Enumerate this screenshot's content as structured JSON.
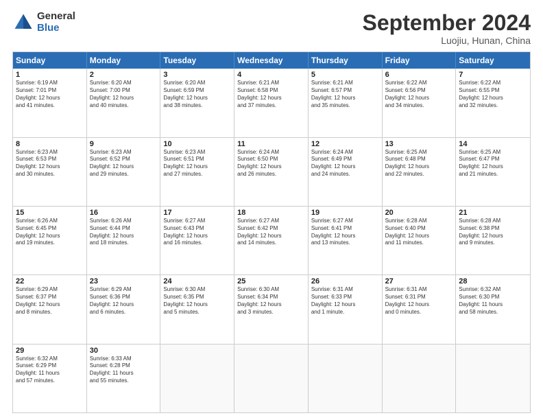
{
  "logo": {
    "general": "General",
    "blue": "Blue"
  },
  "title": "September 2024",
  "location": "Luojiu, Hunan, China",
  "days_header": [
    "Sunday",
    "Monday",
    "Tuesday",
    "Wednesday",
    "Thursday",
    "Friday",
    "Saturday"
  ],
  "weeks": [
    [
      {
        "day": "1",
        "lines": [
          "Sunrise: 6:19 AM",
          "Sunset: 7:01 PM",
          "Daylight: 12 hours",
          "and 41 minutes."
        ]
      },
      {
        "day": "2",
        "lines": [
          "Sunrise: 6:20 AM",
          "Sunset: 7:00 PM",
          "Daylight: 12 hours",
          "and 40 minutes."
        ]
      },
      {
        "day": "3",
        "lines": [
          "Sunrise: 6:20 AM",
          "Sunset: 6:59 PM",
          "Daylight: 12 hours",
          "and 38 minutes."
        ]
      },
      {
        "day": "4",
        "lines": [
          "Sunrise: 6:21 AM",
          "Sunset: 6:58 PM",
          "Daylight: 12 hours",
          "and 37 minutes."
        ]
      },
      {
        "day": "5",
        "lines": [
          "Sunrise: 6:21 AM",
          "Sunset: 6:57 PM",
          "Daylight: 12 hours",
          "and 35 minutes."
        ]
      },
      {
        "day": "6",
        "lines": [
          "Sunrise: 6:22 AM",
          "Sunset: 6:56 PM",
          "Daylight: 12 hours",
          "and 34 minutes."
        ]
      },
      {
        "day": "7",
        "lines": [
          "Sunrise: 6:22 AM",
          "Sunset: 6:55 PM",
          "Daylight: 12 hours",
          "and 32 minutes."
        ]
      }
    ],
    [
      {
        "day": "8",
        "lines": [
          "Sunrise: 6:23 AM",
          "Sunset: 6:53 PM",
          "Daylight: 12 hours",
          "and 30 minutes."
        ]
      },
      {
        "day": "9",
        "lines": [
          "Sunrise: 6:23 AM",
          "Sunset: 6:52 PM",
          "Daylight: 12 hours",
          "and 29 minutes."
        ]
      },
      {
        "day": "10",
        "lines": [
          "Sunrise: 6:23 AM",
          "Sunset: 6:51 PM",
          "Daylight: 12 hours",
          "and 27 minutes."
        ]
      },
      {
        "day": "11",
        "lines": [
          "Sunrise: 6:24 AM",
          "Sunset: 6:50 PM",
          "Daylight: 12 hours",
          "and 26 minutes."
        ]
      },
      {
        "day": "12",
        "lines": [
          "Sunrise: 6:24 AM",
          "Sunset: 6:49 PM",
          "Daylight: 12 hours",
          "and 24 minutes."
        ]
      },
      {
        "day": "13",
        "lines": [
          "Sunrise: 6:25 AM",
          "Sunset: 6:48 PM",
          "Daylight: 12 hours",
          "and 22 minutes."
        ]
      },
      {
        "day": "14",
        "lines": [
          "Sunrise: 6:25 AM",
          "Sunset: 6:47 PM",
          "Daylight: 12 hours",
          "and 21 minutes."
        ]
      }
    ],
    [
      {
        "day": "15",
        "lines": [
          "Sunrise: 6:26 AM",
          "Sunset: 6:45 PM",
          "Daylight: 12 hours",
          "and 19 minutes."
        ]
      },
      {
        "day": "16",
        "lines": [
          "Sunrise: 6:26 AM",
          "Sunset: 6:44 PM",
          "Daylight: 12 hours",
          "and 18 minutes."
        ]
      },
      {
        "day": "17",
        "lines": [
          "Sunrise: 6:27 AM",
          "Sunset: 6:43 PM",
          "Daylight: 12 hours",
          "and 16 minutes."
        ]
      },
      {
        "day": "18",
        "lines": [
          "Sunrise: 6:27 AM",
          "Sunset: 6:42 PM",
          "Daylight: 12 hours",
          "and 14 minutes."
        ]
      },
      {
        "day": "19",
        "lines": [
          "Sunrise: 6:27 AM",
          "Sunset: 6:41 PM",
          "Daylight: 12 hours",
          "and 13 minutes."
        ]
      },
      {
        "day": "20",
        "lines": [
          "Sunrise: 6:28 AM",
          "Sunset: 6:40 PM",
          "Daylight: 12 hours",
          "and 11 minutes."
        ]
      },
      {
        "day": "21",
        "lines": [
          "Sunrise: 6:28 AM",
          "Sunset: 6:38 PM",
          "Daylight: 12 hours",
          "and 9 minutes."
        ]
      }
    ],
    [
      {
        "day": "22",
        "lines": [
          "Sunrise: 6:29 AM",
          "Sunset: 6:37 PM",
          "Daylight: 12 hours",
          "and 8 minutes."
        ]
      },
      {
        "day": "23",
        "lines": [
          "Sunrise: 6:29 AM",
          "Sunset: 6:36 PM",
          "Daylight: 12 hours",
          "and 6 minutes."
        ]
      },
      {
        "day": "24",
        "lines": [
          "Sunrise: 6:30 AM",
          "Sunset: 6:35 PM",
          "Daylight: 12 hours",
          "and 5 minutes."
        ]
      },
      {
        "day": "25",
        "lines": [
          "Sunrise: 6:30 AM",
          "Sunset: 6:34 PM",
          "Daylight: 12 hours",
          "and 3 minutes."
        ]
      },
      {
        "day": "26",
        "lines": [
          "Sunrise: 6:31 AM",
          "Sunset: 6:33 PM",
          "Daylight: 12 hours",
          "and 1 minute."
        ]
      },
      {
        "day": "27",
        "lines": [
          "Sunrise: 6:31 AM",
          "Sunset: 6:31 PM",
          "Daylight: 12 hours",
          "and 0 minutes."
        ]
      },
      {
        "day": "28",
        "lines": [
          "Sunrise: 6:32 AM",
          "Sunset: 6:30 PM",
          "Daylight: 11 hours",
          "and 58 minutes."
        ]
      }
    ],
    [
      {
        "day": "29",
        "lines": [
          "Sunrise: 6:32 AM",
          "Sunset: 6:29 PM",
          "Daylight: 11 hours",
          "and 57 minutes."
        ]
      },
      {
        "day": "30",
        "lines": [
          "Sunrise: 6:33 AM",
          "Sunset: 6:28 PM",
          "Daylight: 11 hours",
          "and 55 minutes."
        ]
      },
      {
        "day": "",
        "lines": []
      },
      {
        "day": "",
        "lines": []
      },
      {
        "day": "",
        "lines": []
      },
      {
        "day": "",
        "lines": []
      },
      {
        "day": "",
        "lines": []
      }
    ]
  ]
}
